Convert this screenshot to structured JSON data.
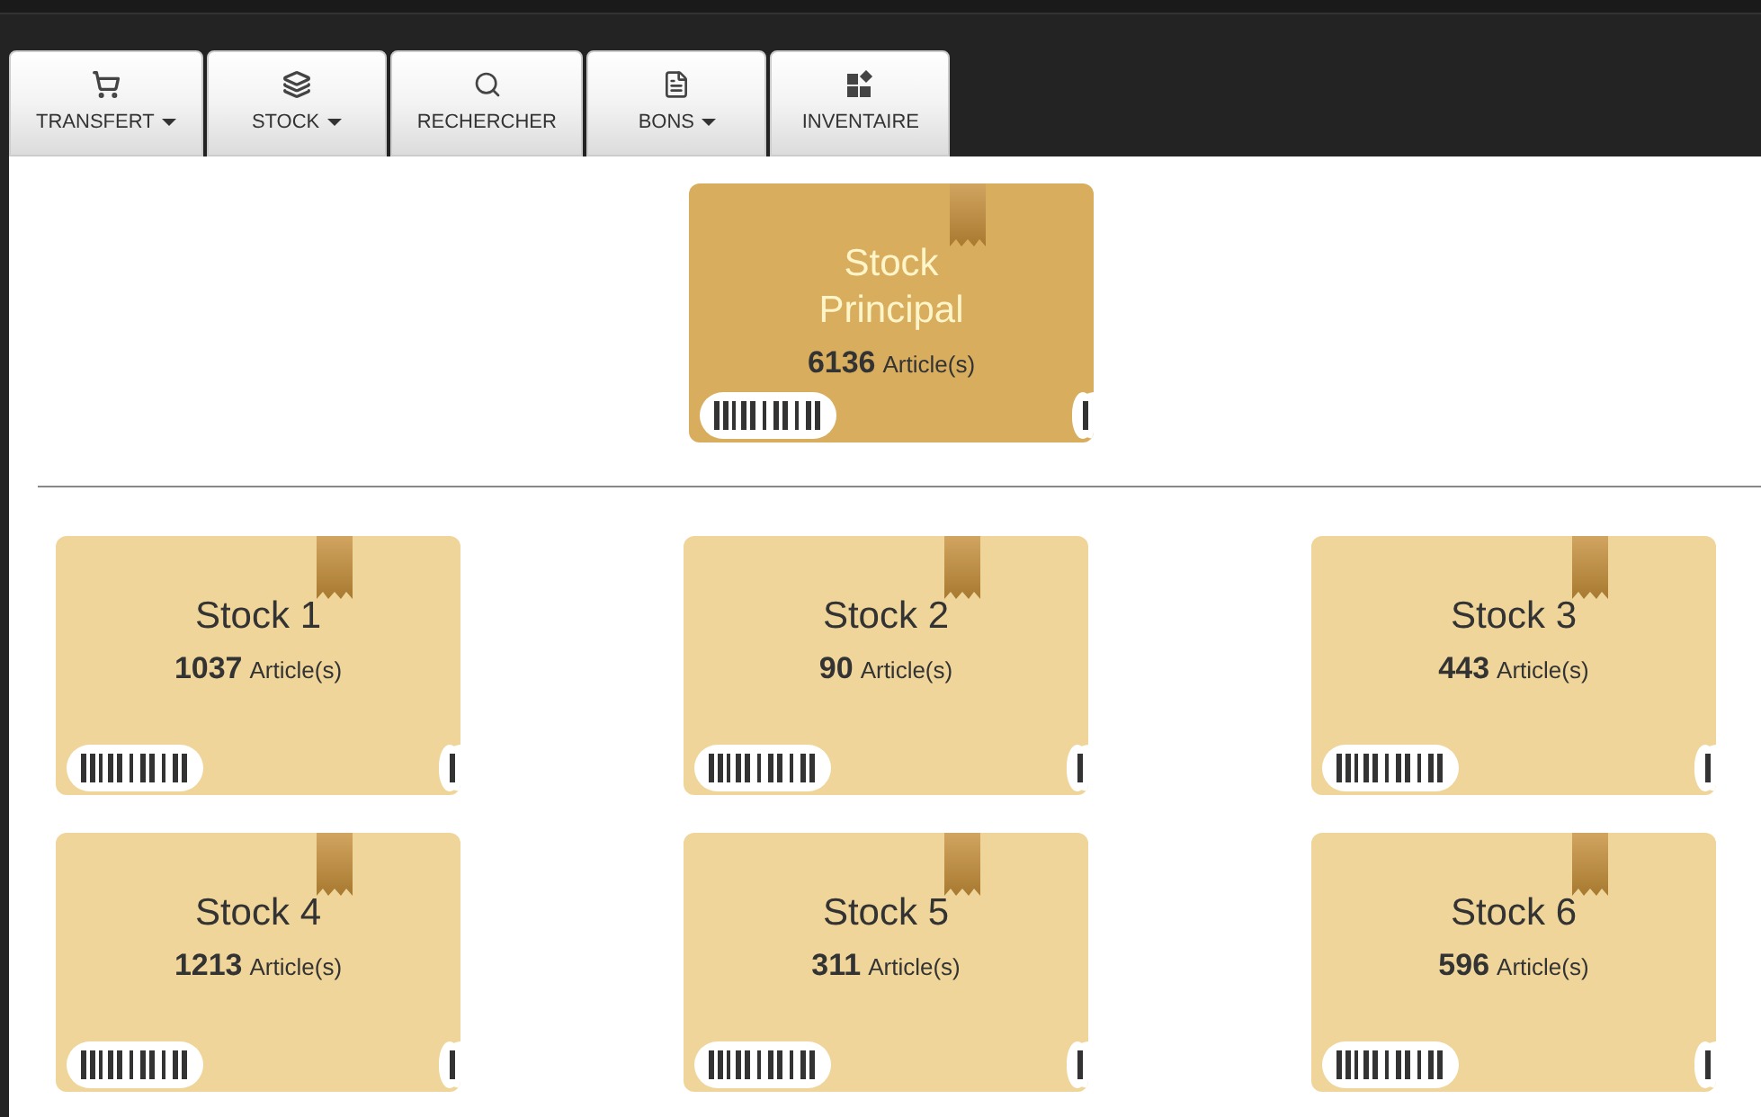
{
  "tabs": [
    {
      "label": "TRANSFERT",
      "kind": "cart",
      "has_menu": true
    },
    {
      "label": "STOCK",
      "kind": "layers",
      "has_menu": true
    },
    {
      "label": "RECHERCHER",
      "kind": "search",
      "has_menu": false
    },
    {
      "label": "BONS",
      "kind": "document",
      "has_menu": true
    },
    {
      "label": "INVENTAIRE",
      "kind": "blocks",
      "has_menu": false
    }
  ],
  "main_stock": {
    "kind": "main",
    "name": "Stock Principal",
    "count": "6136",
    "unit": "Article(s)"
  },
  "stocks": [
    {
      "kind": "sub",
      "name": "Stock 1",
      "count": "1037",
      "unit": "Article(s)"
    },
    {
      "kind": "sub",
      "name": "Stock 2",
      "count": "90",
      "unit": "Article(s)"
    },
    {
      "kind": "sub",
      "name": "Stock 3",
      "count": "443",
      "unit": "Article(s)"
    },
    {
      "kind": "sub",
      "name": "Stock 4",
      "count": "1213",
      "unit": "Article(s)"
    },
    {
      "kind": "sub",
      "name": "Stock 5",
      "count": "311",
      "unit": "Article(s)"
    },
    {
      "kind": "sub",
      "name": "Stock 6",
      "count": "596",
      "unit": "Article(s)"
    }
  ]
}
